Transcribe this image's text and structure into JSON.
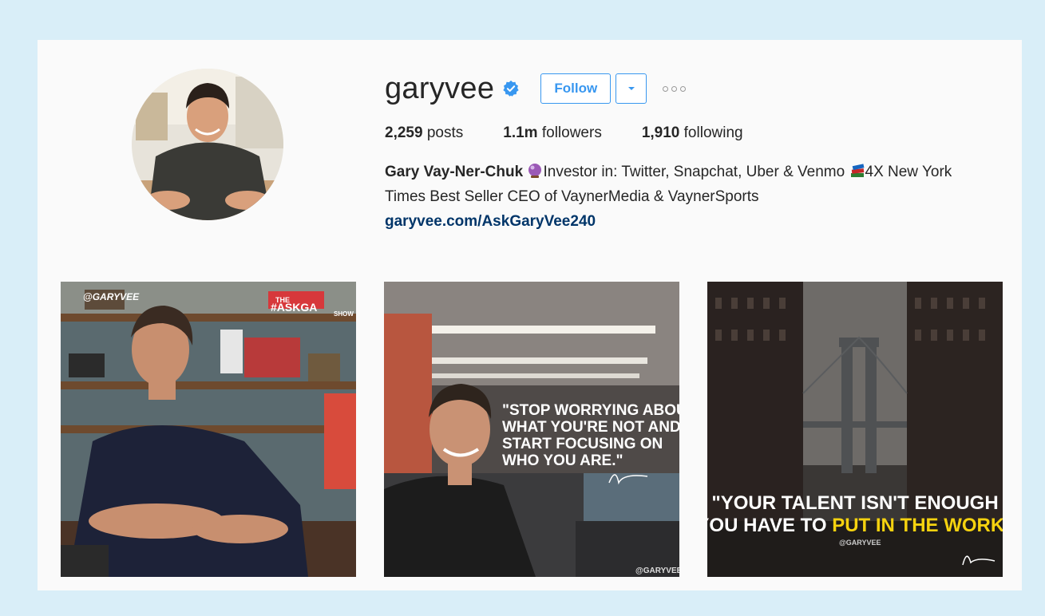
{
  "profile": {
    "username": "garyvee",
    "verified": true,
    "follow_label": "Follow",
    "stats": {
      "posts_count": "2,259",
      "posts_label": "posts",
      "followers_count": "1.1m",
      "followers_label": "followers",
      "following_count": "1,910",
      "following_label": "following"
    },
    "full_name": "Gary Vay-Ner-Chuk",
    "bio_part1": "Investor in: Twitter, Snapchat, Uber & Venmo",
    "bio_part2": "4X New York Times Best Seller CEO of VaynerMedia & VaynerSports",
    "link": "garyvee.com/AskGaryVee240",
    "icons": {
      "verified": "verified-badge-icon",
      "bio_emoji_1": "crystal-ball-icon",
      "bio_emoji_2": "books-icon",
      "caret": "chevron-down-icon",
      "more": "more-options-icon"
    }
  },
  "posts": [
    {
      "overlay_tag_1": "@GARYVEE",
      "overlay_tag_2": "THE",
      "overlay_tag_3": "#ASKGA",
      "overlay_tag_4": "SHOW"
    },
    {
      "quote_line_1": "\"STOP WORRYING ABOUT",
      "quote_line_2": "WHAT YOU'RE NOT AND",
      "quote_line_3": "START FOCUSING ON",
      "quote_line_4": "WHO YOU ARE.\"",
      "handle": "@GARYVEE"
    },
    {
      "quote_line_1": "\"YOUR TALENT ISN'T ENOUGH",
      "quote_line_2a": "YOU HAVE TO ",
      "quote_line_2b": "PUT IN THE WORK",
      "quote_line_2c": "\"",
      "handle": "@GARYVEE"
    }
  ],
  "colors": {
    "background": "#d9eef8",
    "card": "#fafafa",
    "accent_blue": "#3897f0",
    "link_blue": "#003569",
    "highlight_yellow": "#f5d20f"
  }
}
